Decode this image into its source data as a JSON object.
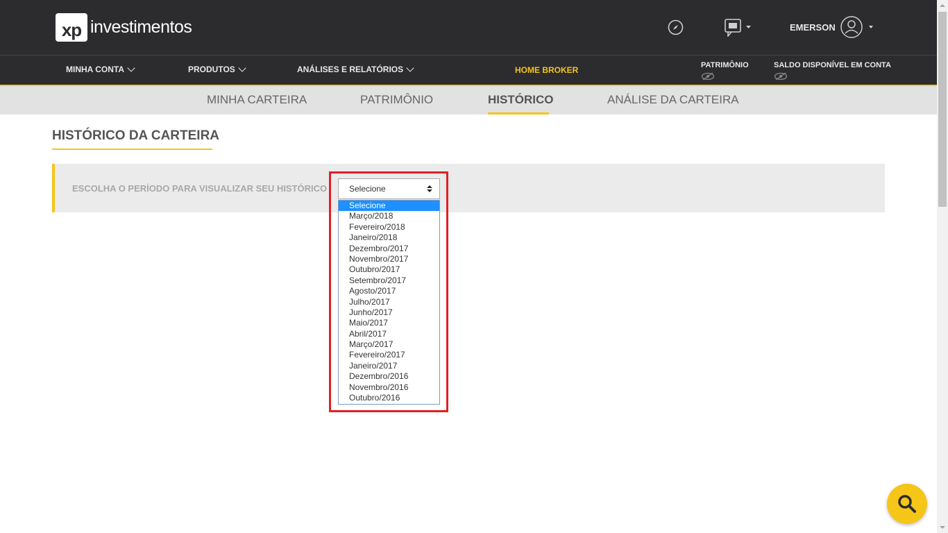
{
  "brand": {
    "logo_mark": "xp",
    "logo_text": "investimentos"
  },
  "header": {
    "user_name": "EMERSON",
    "icons": [
      "compass-icon",
      "chat-icon",
      "avatar-icon"
    ]
  },
  "nav": {
    "items": [
      {
        "label": "MINHA CONTA"
      },
      {
        "label": "PRODUTOS"
      },
      {
        "label": "ANÁLISES E RELATÓRIOS"
      }
    ],
    "home_broker": "HOME BROKER",
    "patrimonio": "PATRIMÔNIO",
    "saldo": "SALDO DISPONÍVEL EM CONTA"
  },
  "subnav": {
    "tabs": [
      {
        "label": "MINHA CARTEIRA"
      },
      {
        "label": "PATRIMÔNIO"
      },
      {
        "label": "HISTÓRICO"
      },
      {
        "label": "ANÁLISE DA CARTEIRA"
      }
    ],
    "active": "HISTÓRICO"
  },
  "main": {
    "title": "HISTÓRICO DA CARTEIRA",
    "period_label": "ESCOLHA O PERÍODO PARA VISUALIZAR SEU HISTÓRICO",
    "select_value": "Selecione",
    "options": [
      "Selecione",
      "Março/2018",
      "Fevereiro/2018",
      "Janeiro/2018",
      "Dezembro/2017",
      "Novembro/2017",
      "Outubro/2017",
      "Setembro/2017",
      "Agosto/2017",
      "Julho/2017",
      "Junho/2017",
      "Maio/2017",
      "Abril/2017",
      "Março/2017",
      "Fevereiro/2017",
      "Janeiro/2017",
      "Dezembro/2016",
      "Novembro/2016",
      "Outubro/2016"
    ]
  },
  "colors": {
    "accent": "#f5c518",
    "header_bg": "#2c2c2e",
    "highlight": "#e31e24",
    "option_selected": "#1e90ff"
  }
}
